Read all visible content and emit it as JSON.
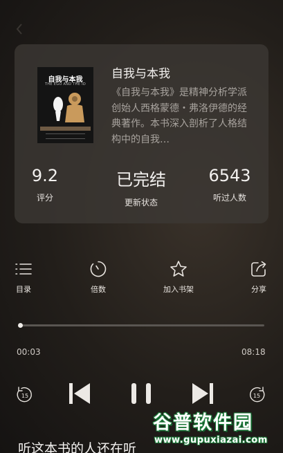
{
  "book": {
    "title": "自我与本我",
    "description": "《自我与本我》是精神分析学派创始人西格蒙德・弗洛伊德的经典著作。本书深入剖析了人格结构中的自我…",
    "cover": {
      "title": "自我与本我",
      "subtitle": "THE EGO AND THE ID"
    }
  },
  "stats": [
    {
      "value": "9.2",
      "label": "评分"
    },
    {
      "value": "已完结",
      "label": "更新状态"
    },
    {
      "value": "6543",
      "label": "听过人数"
    }
  ],
  "toolbar": {
    "menu_label": "目录",
    "speed_label": "倍数",
    "shelf_label": "加入书架",
    "share_label": "分享"
  },
  "player": {
    "current_time": "00:03",
    "total_time": "08:18",
    "progress_fraction": 0.006,
    "rewind_seconds": "15",
    "forward_seconds": "15"
  },
  "section": {
    "listeners_title": "听这本书的人还在听"
  },
  "watermark": {
    "text": "谷普软件园",
    "url": "www.gupuxiazai.com"
  },
  "colors": {
    "background": "#221e1a",
    "card": "#3c3834",
    "text_primary": "#f2f0ee",
    "text_secondary": "#a8a39e",
    "watermark_green": "#1d7a3a"
  }
}
